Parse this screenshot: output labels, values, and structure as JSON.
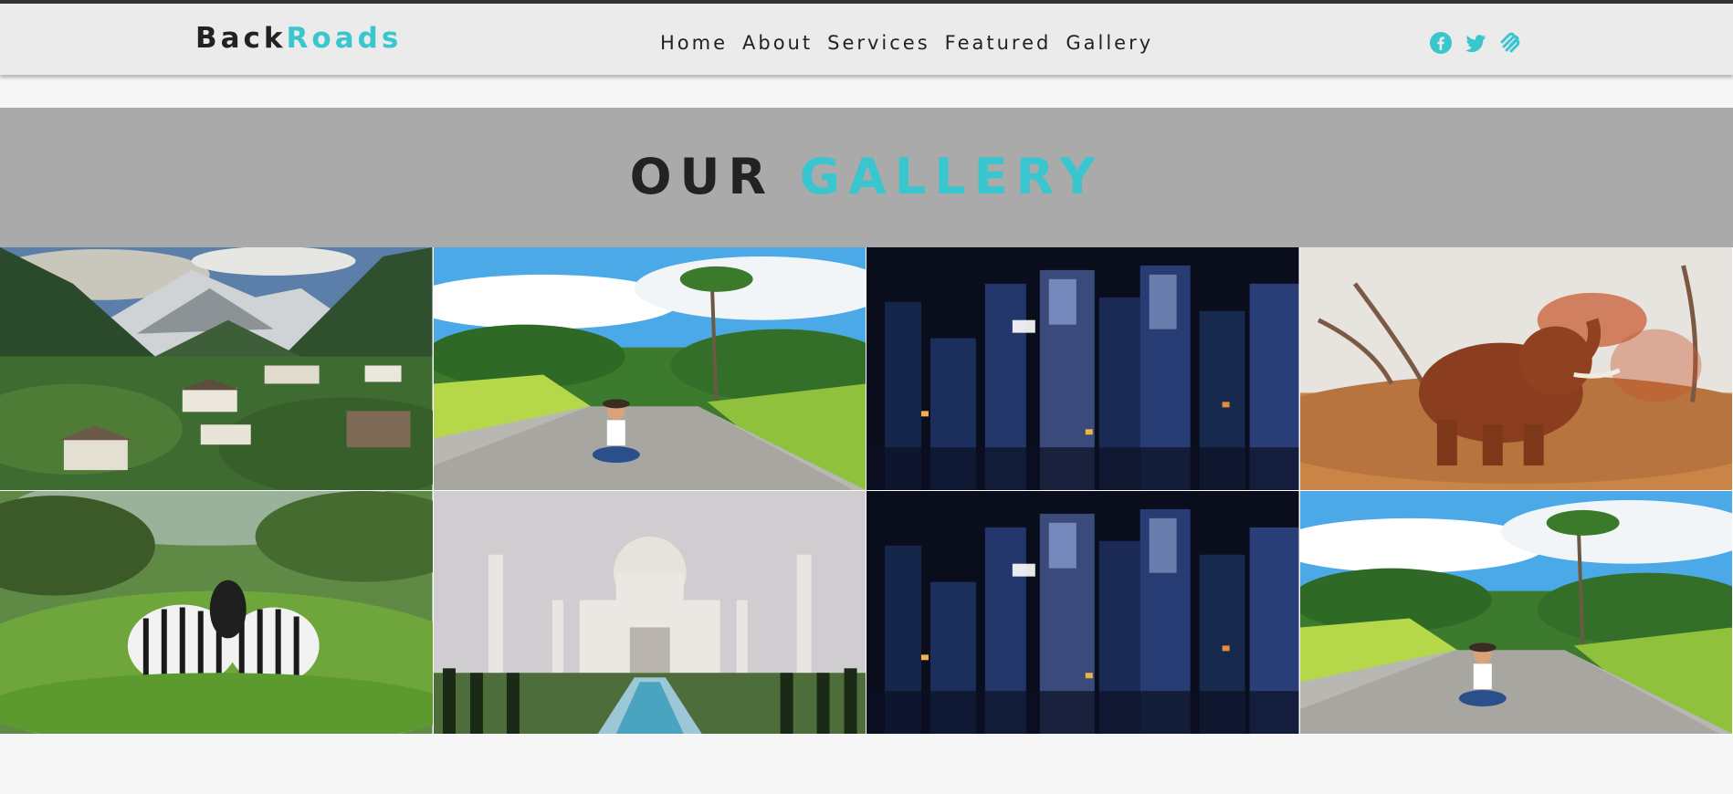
{
  "brand": {
    "first": "Back",
    "second": "Roads",
    "accent_color": "#3ac6cf"
  },
  "nav": {
    "links": [
      "Home",
      "About",
      "Services",
      "Featured",
      "Gallery"
    ]
  },
  "social": {
    "icons": [
      "facebook-icon",
      "twitter-icon",
      "squarespace-icon"
    ],
    "color": "#3ac6cf"
  },
  "gallery": {
    "title_first": "OUR",
    "title_second": "GALLERY",
    "images": [
      "mountain-village-image",
      "woman-on-road-image",
      "city-night-image",
      "elephant-image",
      "zebras-image",
      "taj-mahal-image",
      "city-night-image",
      "woman-on-road-image"
    ]
  }
}
